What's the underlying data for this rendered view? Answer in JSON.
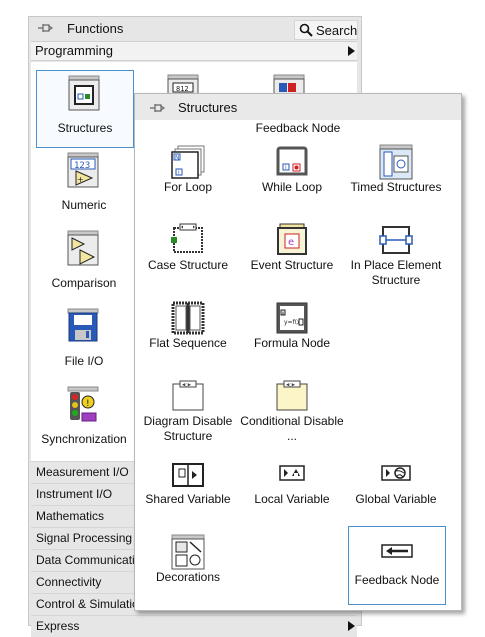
{
  "functions_palette": {
    "title": "Functions",
    "search_label": "Search",
    "category": "Programming",
    "items": [
      {
        "label": "Structures"
      },
      {
        "label": "Numeric"
      },
      {
        "label": "Comparison"
      },
      {
        "label": "File I/O"
      },
      {
        "label": "Synchronization"
      }
    ],
    "categories": [
      {
        "label": "Measurement I/O"
      },
      {
        "label": "Instrument I/O"
      },
      {
        "label": "Mathematics"
      },
      {
        "label": "Signal Processing"
      },
      {
        "label": "Data Communication"
      },
      {
        "label": "Connectivity"
      },
      {
        "label": "Control & Simulation"
      },
      {
        "label": "Express"
      }
    ]
  },
  "structures_palette": {
    "title": "Structures",
    "hover_label": "Feedback Node",
    "items": [
      {
        "label": "For Loop"
      },
      {
        "label": "While Loop"
      },
      {
        "label": "Timed Structures"
      },
      {
        "label": "Case Structure"
      },
      {
        "label": "Event Structure"
      },
      {
        "label": "In Place Element Structure"
      },
      {
        "label": "Flat Sequence"
      },
      {
        "label": "Formula Node"
      },
      {
        "label": "Diagram Disable Structure"
      },
      {
        "label": "Conditional Disable ..."
      },
      {
        "label": "Shared Variable"
      },
      {
        "label": "Local Variable"
      },
      {
        "label": "Global Variable"
      },
      {
        "label": "Decorations"
      },
      {
        "label": "Feedback Node"
      }
    ]
  }
}
